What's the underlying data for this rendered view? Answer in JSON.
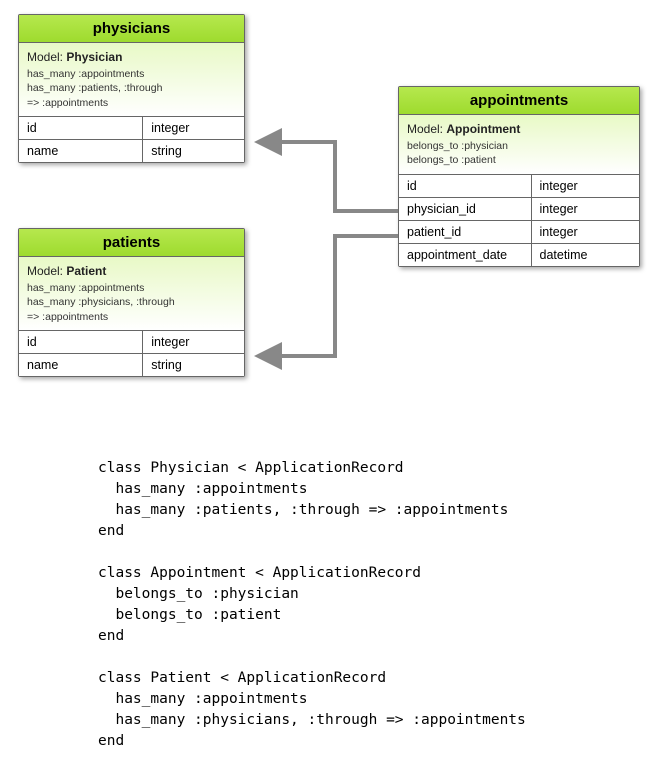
{
  "entities": {
    "physicians": {
      "title": "physicians",
      "model_label": "Model:",
      "model_name": "Physician",
      "assocs": [
        "has_many :appointments",
        "has_many :patients, :through",
        "=> :appointments"
      ],
      "columns": [
        {
          "name": "id",
          "type": "integer"
        },
        {
          "name": "name",
          "type": "string"
        }
      ]
    },
    "patients": {
      "title": "patients",
      "model_label": "Model:",
      "model_name": "Patient",
      "assocs": [
        "has_many :appointments",
        "has_many :physicians, :through",
        "=> :appointments"
      ],
      "columns": [
        {
          "name": "id",
          "type": "integer"
        },
        {
          "name": "name",
          "type": "string"
        }
      ]
    },
    "appointments": {
      "title": "appointments",
      "model_label": "Model:",
      "model_name": "Appointment",
      "assocs": [
        "belongs_to :physician",
        "belongs_to :patient"
      ],
      "columns": [
        {
          "name": "id",
          "type": "integer"
        },
        {
          "name": "physician_id",
          "type": "integer"
        },
        {
          "name": "patient_id",
          "type": "integer"
        },
        {
          "name": "appointment_date",
          "type": "datetime"
        }
      ]
    }
  },
  "code": "class Physician < ApplicationRecord\n  has_many :appointments\n  has_many :patients, :through => :appointments\nend\n\nclass Appointment < ApplicationRecord\n  belongs_to :physician\n  belongs_to :patient\nend\n\nclass Patient < ApplicationRecord\n  has_many :appointments\n  has_many :physicians, :through => :appointments\nend"
}
